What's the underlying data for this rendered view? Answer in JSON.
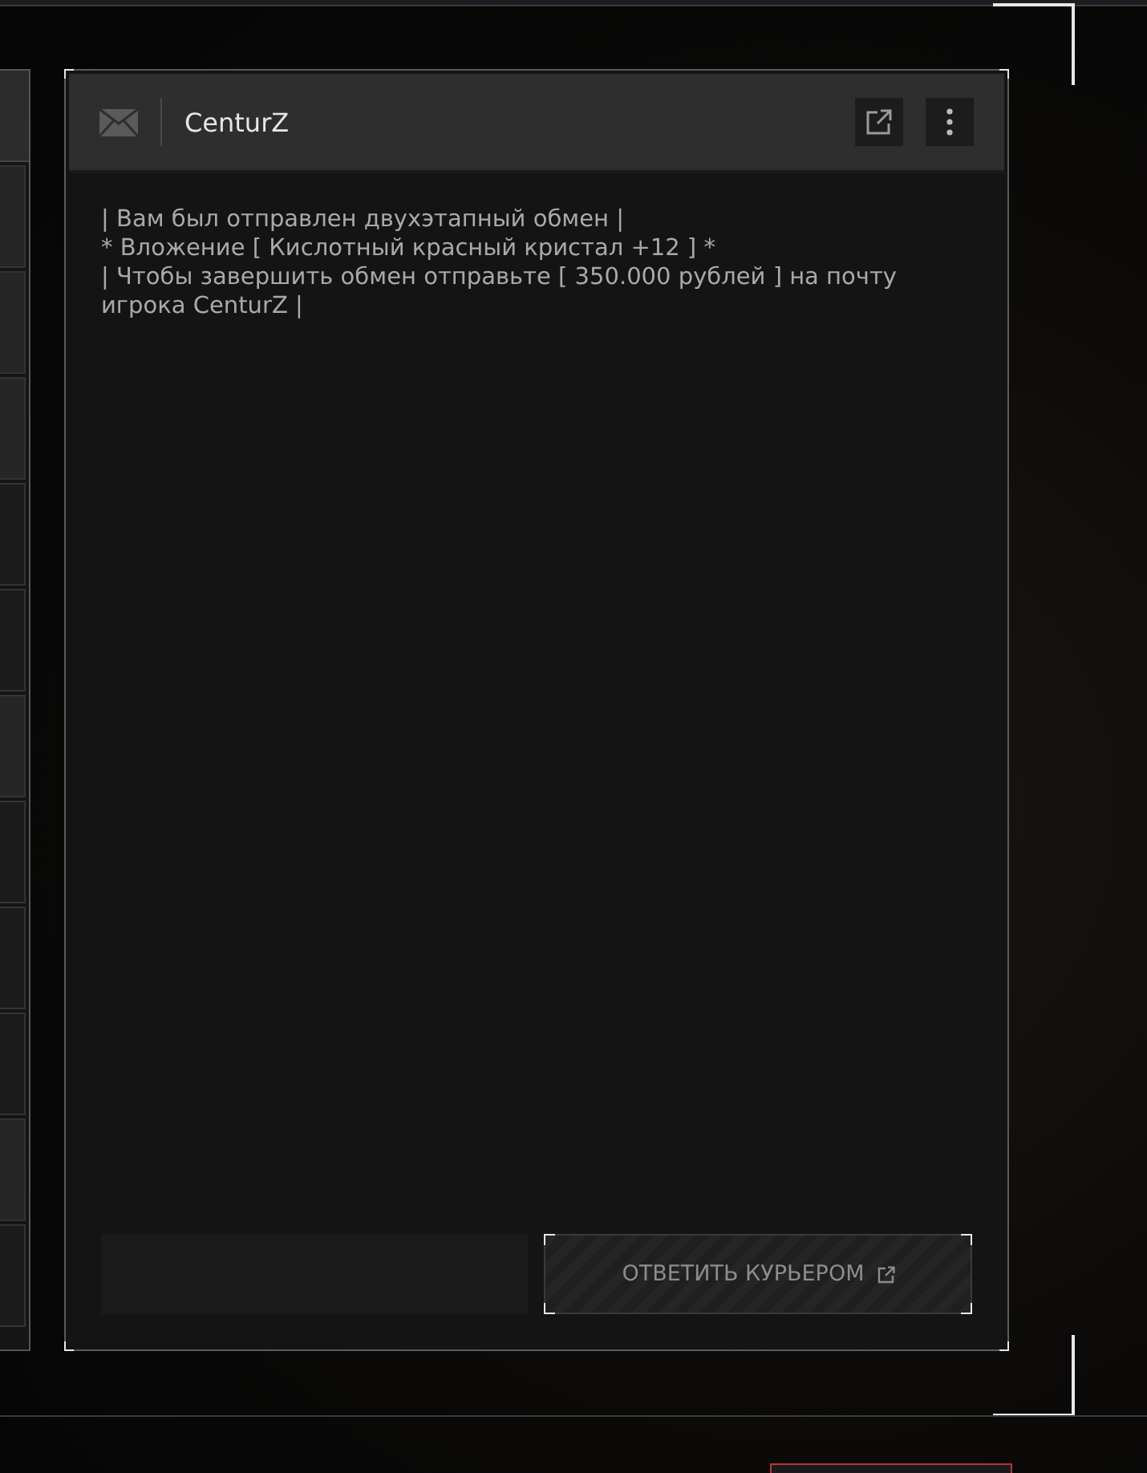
{
  "message": {
    "sender": "CenturZ",
    "lines": [
      "| Вам был отправлен двухэтапный обмен |",
      "* Вложение [ Кислотный красный кристал +12 ] *",
      "| Чтобы завершить обмен отправьте [ 350.000 рублей ] на почту игрока CenturZ |"
    ],
    "reply_button": "ОТВЕТИТЬ КУРЬЕРОМ"
  }
}
